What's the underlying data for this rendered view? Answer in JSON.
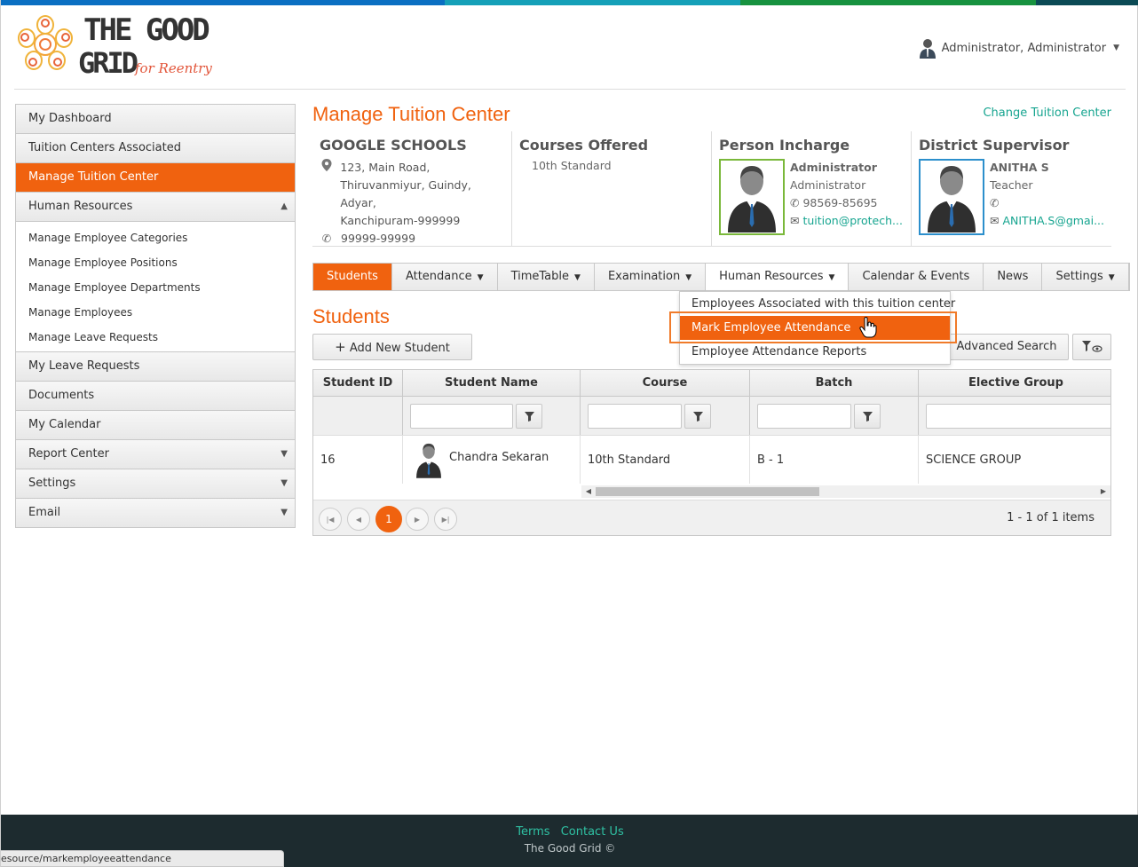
{
  "colors": {
    "accent": "#f0620f",
    "link": "#17a590",
    "footer_bg": "#1d2b2f",
    "green_border": "#7ab83a",
    "blue_border": "#2c8fcc"
  },
  "logo": {
    "line1": "THE GOOD",
    "line2": "GRID",
    "tagline": "for Reentry"
  },
  "user": {
    "name": "Administrator, Administrator",
    "icon": "user-icon"
  },
  "sidebar": {
    "items": [
      {
        "label": "My Dashboard"
      },
      {
        "label": "Tuition Centers Associated"
      },
      {
        "label": "Manage Tuition Center",
        "active": true
      },
      {
        "label": "Human Resources",
        "expanded": true
      }
    ],
    "hr_sub": [
      {
        "label": "Manage Employee Categories"
      },
      {
        "label": "Manage Employee Positions"
      },
      {
        "label": "Manage Employee Departments"
      },
      {
        "label": "Manage Employees"
      },
      {
        "label": "Manage Leave Requests"
      }
    ],
    "items_after": [
      {
        "label": "My Leave Requests"
      },
      {
        "label": "Documents"
      },
      {
        "label": "My Calendar"
      },
      {
        "label": "Report Center"
      },
      {
        "label": "Settings"
      },
      {
        "label": "Email"
      }
    ]
  },
  "main": {
    "title": "Manage Tuition Center",
    "change_link": "Change Tuition Center",
    "school": {
      "name": "GOOGLE SCHOOLS",
      "address_lines": [
        "123, Main Road,",
        "Thiruvanmiyur, Guindy, Adyar,",
        "Kanchipuram-999999"
      ],
      "phone": "99999-99999"
    },
    "courses": {
      "heading": "Courses Offered",
      "items": [
        "10th Standard"
      ]
    },
    "person_incharge": {
      "heading": "Person Incharge",
      "name": "Administrator",
      "role": "Administrator",
      "phone": "98569-85695",
      "email": "tuition@protech..."
    },
    "district_supervisor": {
      "heading": "District Supervisor",
      "name": "ANITHA S",
      "role": "Teacher",
      "phone": "",
      "email": "ANITHA.S@gmai..."
    },
    "tabs": [
      {
        "label": "Students",
        "dropdown": false,
        "active": true
      },
      {
        "label": "Attendance",
        "dropdown": true
      },
      {
        "label": "TimeTable",
        "dropdown": true
      },
      {
        "label": "Examination",
        "dropdown": true
      },
      {
        "label": "Human Resources",
        "dropdown": true,
        "open": true
      },
      {
        "label": "Calendar & Events",
        "dropdown": false
      },
      {
        "label": "News",
        "dropdown": false
      },
      {
        "label": "Settings",
        "dropdown": true
      }
    ],
    "hr_dropdown": [
      {
        "label": "Employees Associated with this tuition center"
      },
      {
        "label": "Mark Employee Attendance",
        "highlighted": true
      },
      {
        "label": "Employee Attendance Reports"
      }
    ],
    "section_title": "Students",
    "add_button": "Add New Student",
    "advanced_search": "Advanced Search",
    "grid": {
      "columns": [
        "Student ID",
        "Student Name",
        "Course",
        "Batch",
        "Elective Group"
      ],
      "rows": [
        {
          "id": "16",
          "name": "Chandra Sekaran",
          "course": "10th Standard",
          "batch": "B - 1",
          "elective": "SCIENCE GROUP"
        }
      ],
      "current_page": "1",
      "pager_info": "1 - 1 of 1 items"
    }
  },
  "footer": {
    "terms": "Terms",
    "contact": "Contact Us",
    "copyright": "The Good Grid ©"
  },
  "status_url": "esource/markemployeeattendance"
}
